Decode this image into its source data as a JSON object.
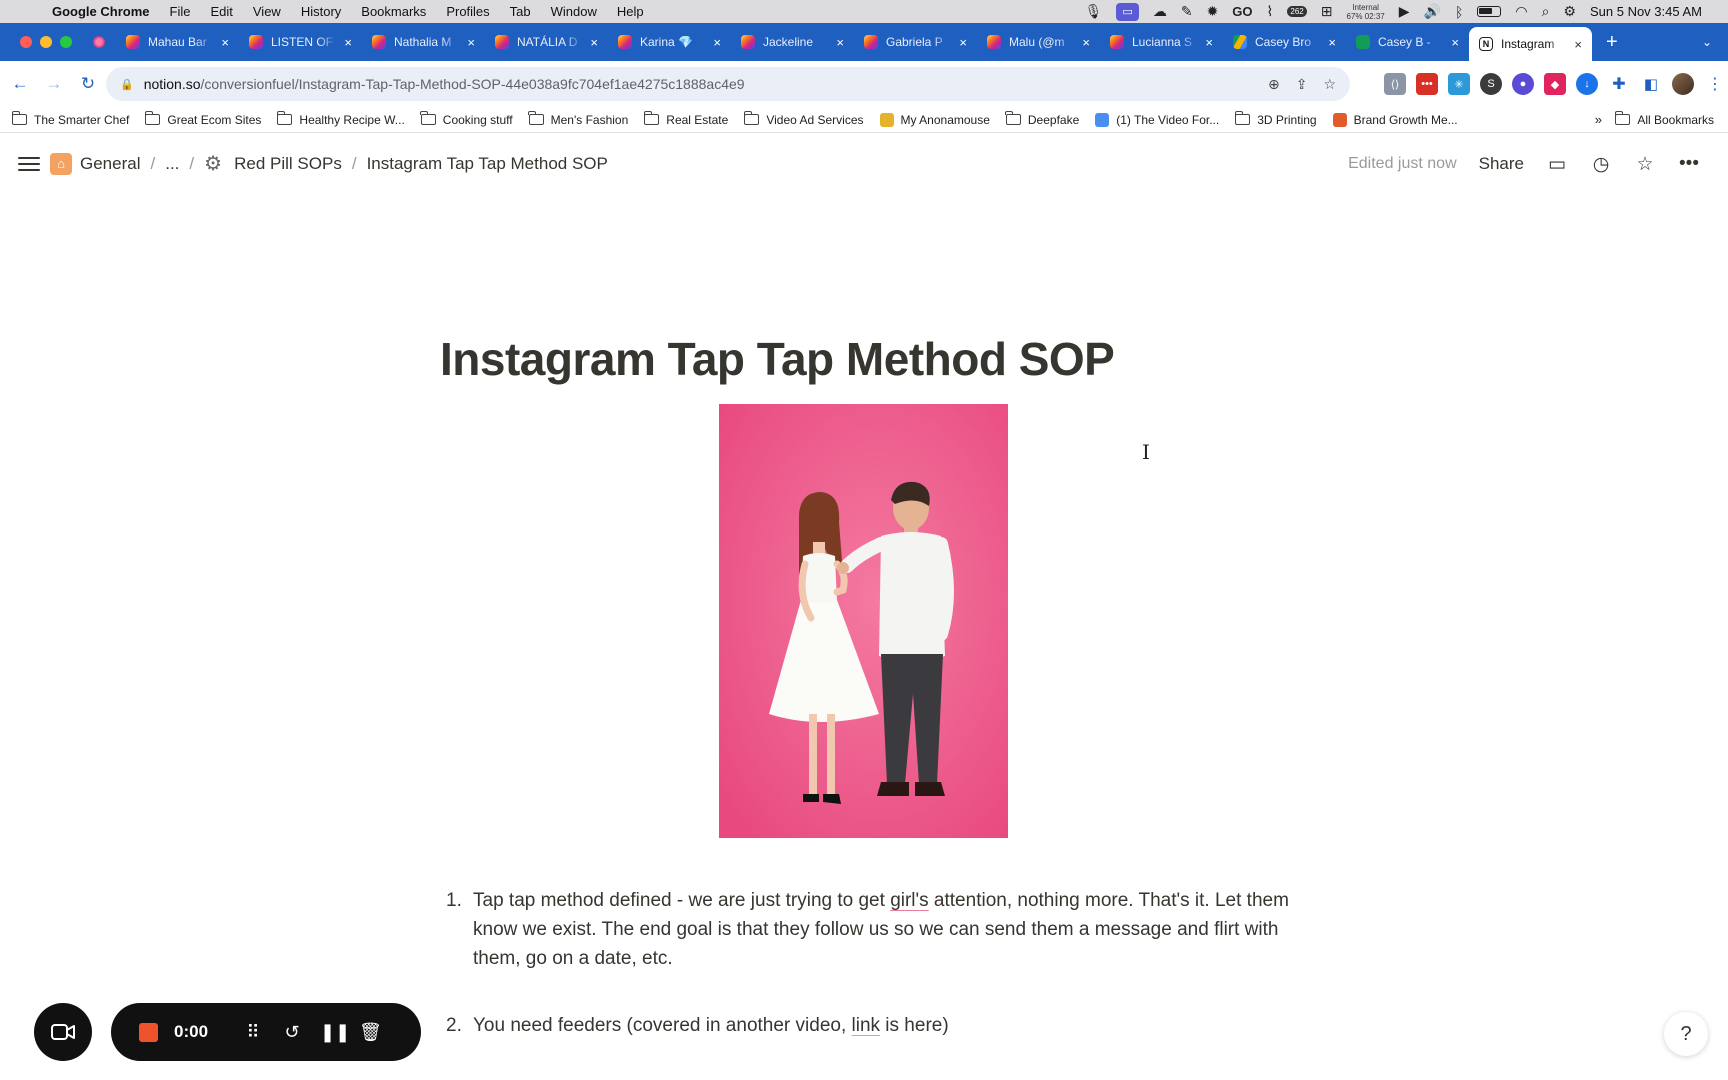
{
  "menubar": {
    "app": "Google Chrome",
    "items": [
      "File",
      "Edit",
      "View",
      "History",
      "Bookmarks",
      "Profiles",
      "Tab",
      "Window",
      "Help"
    ],
    "status": {
      "go": "GO",
      "badge": "262",
      "internal_label": "Internal",
      "internal_value": "67% 02:37",
      "datetime": "Sun 5 Nov  3:45 AM"
    }
  },
  "tabs": [
    {
      "label": "Mahau Bar",
      "favicon": "instagram-icon"
    },
    {
      "label": "LISTEN OF",
      "favicon": "instagram-icon"
    },
    {
      "label": "Nathalia M",
      "favicon": "instagram-icon"
    },
    {
      "label": "NATÁLIA D",
      "favicon": "instagram-icon"
    },
    {
      "label": "Karina 💎",
      "favicon": "instagram-icon"
    },
    {
      "label": "Jackeline",
      "favicon": "instagram-icon"
    },
    {
      "label": "Gabriela P",
      "favicon": "instagram-icon"
    },
    {
      "label": "Malu (@m",
      "favicon": "instagram-icon"
    },
    {
      "label": "Lucianna S",
      "favicon": "instagram-icon"
    },
    {
      "label": "Casey Bro",
      "favicon": "google-drive-icon"
    },
    {
      "label": "Casey B -",
      "favicon": "google-sheets-icon"
    },
    {
      "label": "Instagram",
      "favicon": "notion-icon",
      "active": true
    }
  ],
  "address": {
    "host": "notion.so",
    "path": "/conversionfuel/Instagram-Tap-Tap-Method-SOP-44e038a9fc704ef1ae4275c1888ac4e9"
  },
  "bookmarks": [
    {
      "label": "The Smarter Chef",
      "icon": "folder-icon"
    },
    {
      "label": "Great Ecom Sites",
      "icon": "folder-icon"
    },
    {
      "label": "Healthy Recipe W...",
      "icon": "folder-icon"
    },
    {
      "label": "Cooking stuff",
      "icon": "folder-icon"
    },
    {
      "label": "Men's Fashion",
      "icon": "folder-icon"
    },
    {
      "label": "Real Estate",
      "icon": "folder-icon"
    },
    {
      "label": "Video Ad Services",
      "icon": "folder-icon"
    },
    {
      "label": "My Anonamouse",
      "icon": "mam-icon"
    },
    {
      "label": "Deepfake",
      "icon": "folder-icon"
    },
    {
      "label": "(1) The Video For...",
      "icon": "drop-icon"
    },
    {
      "label": "3D Printing",
      "icon": "folder-icon"
    },
    {
      "label": "Brand Growth Me...",
      "icon": "brand-icon"
    }
  ],
  "bookmarks_more": "»",
  "bookmarks_all": "All Bookmarks",
  "notion": {
    "breadcrumb": {
      "root": "General",
      "ellipsis": "...",
      "parent": "Red Pill SOPs",
      "current": "Instagram Tap Tap Method SOP"
    },
    "edited": "Edited just now",
    "share": "Share",
    "title": "Instagram Tap Tap Method SOP",
    "list": [
      {
        "num": "1.",
        "before": "Tap tap method defined - we are just trying to get ",
        "underlined": "girl's",
        "after": " attention, nothing more. That's it. Let them know we exist. The end goal is that they follow us so we can send them a message and flirt with them, go on a date, etc."
      },
      {
        "num": "2.",
        "before": "You need feeders (covered in another video, ",
        "underlined": "link",
        "after": " is here)"
      }
    ]
  },
  "recorder": {
    "time": "0:00"
  },
  "help": "?",
  "colors": {
    "chrome_tabstrip": "#1f5fc0",
    "cover_bg": "#ee5b8c",
    "record_red": "#f0522e"
  }
}
